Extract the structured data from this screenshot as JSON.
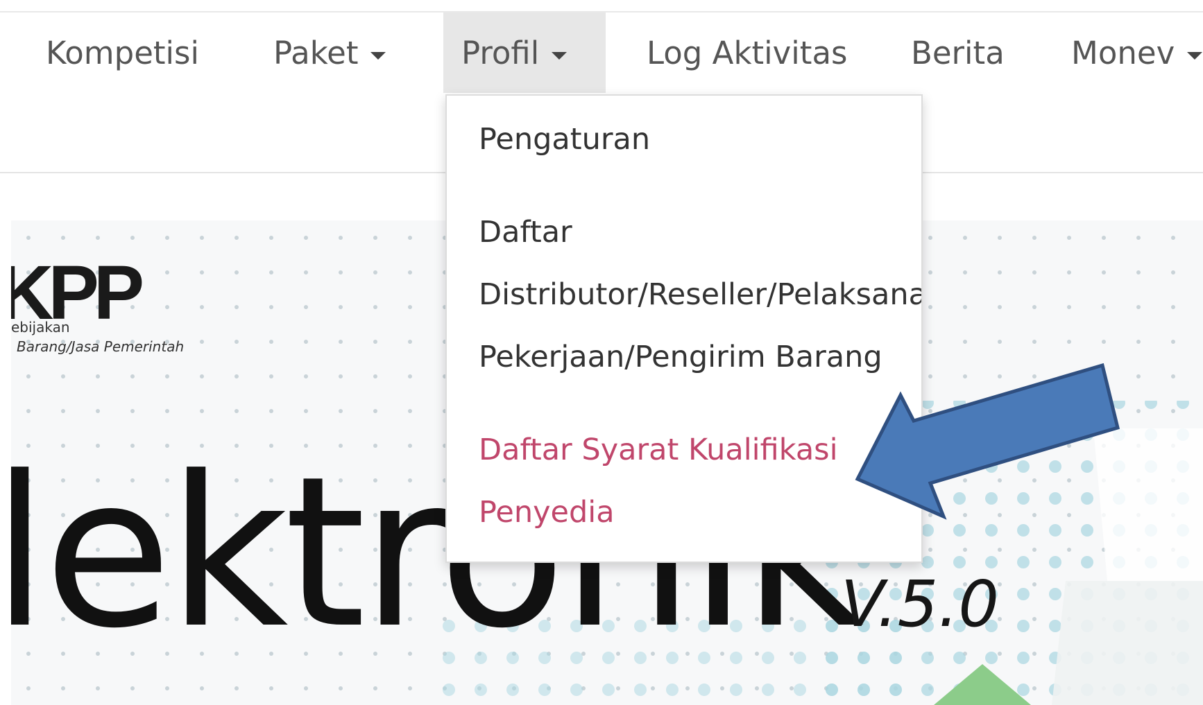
{
  "navbar": {
    "items": [
      {
        "label": "Kompetisi",
        "has_caret": false
      },
      {
        "label": "Paket",
        "has_caret": true
      },
      {
        "label": "Profil",
        "has_caret": true,
        "active": true
      },
      {
        "label": "Log Aktivitas",
        "has_caret": false
      },
      {
        "label": "Berita",
        "has_caret": false
      },
      {
        "label": "Monev",
        "has_caret": true
      }
    ]
  },
  "dropdown": {
    "items": [
      {
        "label": "Pengaturan"
      },
      {
        "label": "Daftar"
      },
      {
        "label": "Distributor/Reseller/Pelaksana"
      },
      {
        "label": "Pekerjaan/Pengirim Barang"
      },
      {
        "label": "Daftar Syarat Kualifikasi"
      },
      {
        "label": "Penyedia"
      }
    ]
  },
  "hero": {
    "logo_mark": "KPP",
    "logo_line1": "ebijakan",
    "logo_line2": "Barang/Jasa Pemerintah",
    "title": "lektronik",
    "version": "V.5.0"
  },
  "colors": {
    "nav_text": "#555555",
    "nav_active_bg": "#e7e7e7",
    "dropdown_highlight": "#c0466b",
    "arrow_fill": "#4a7ab8",
    "arrow_stroke": "#2f4f80"
  },
  "icons": {
    "caret": "caret-down-icon",
    "annotation": "arrow-pointer-icon"
  }
}
